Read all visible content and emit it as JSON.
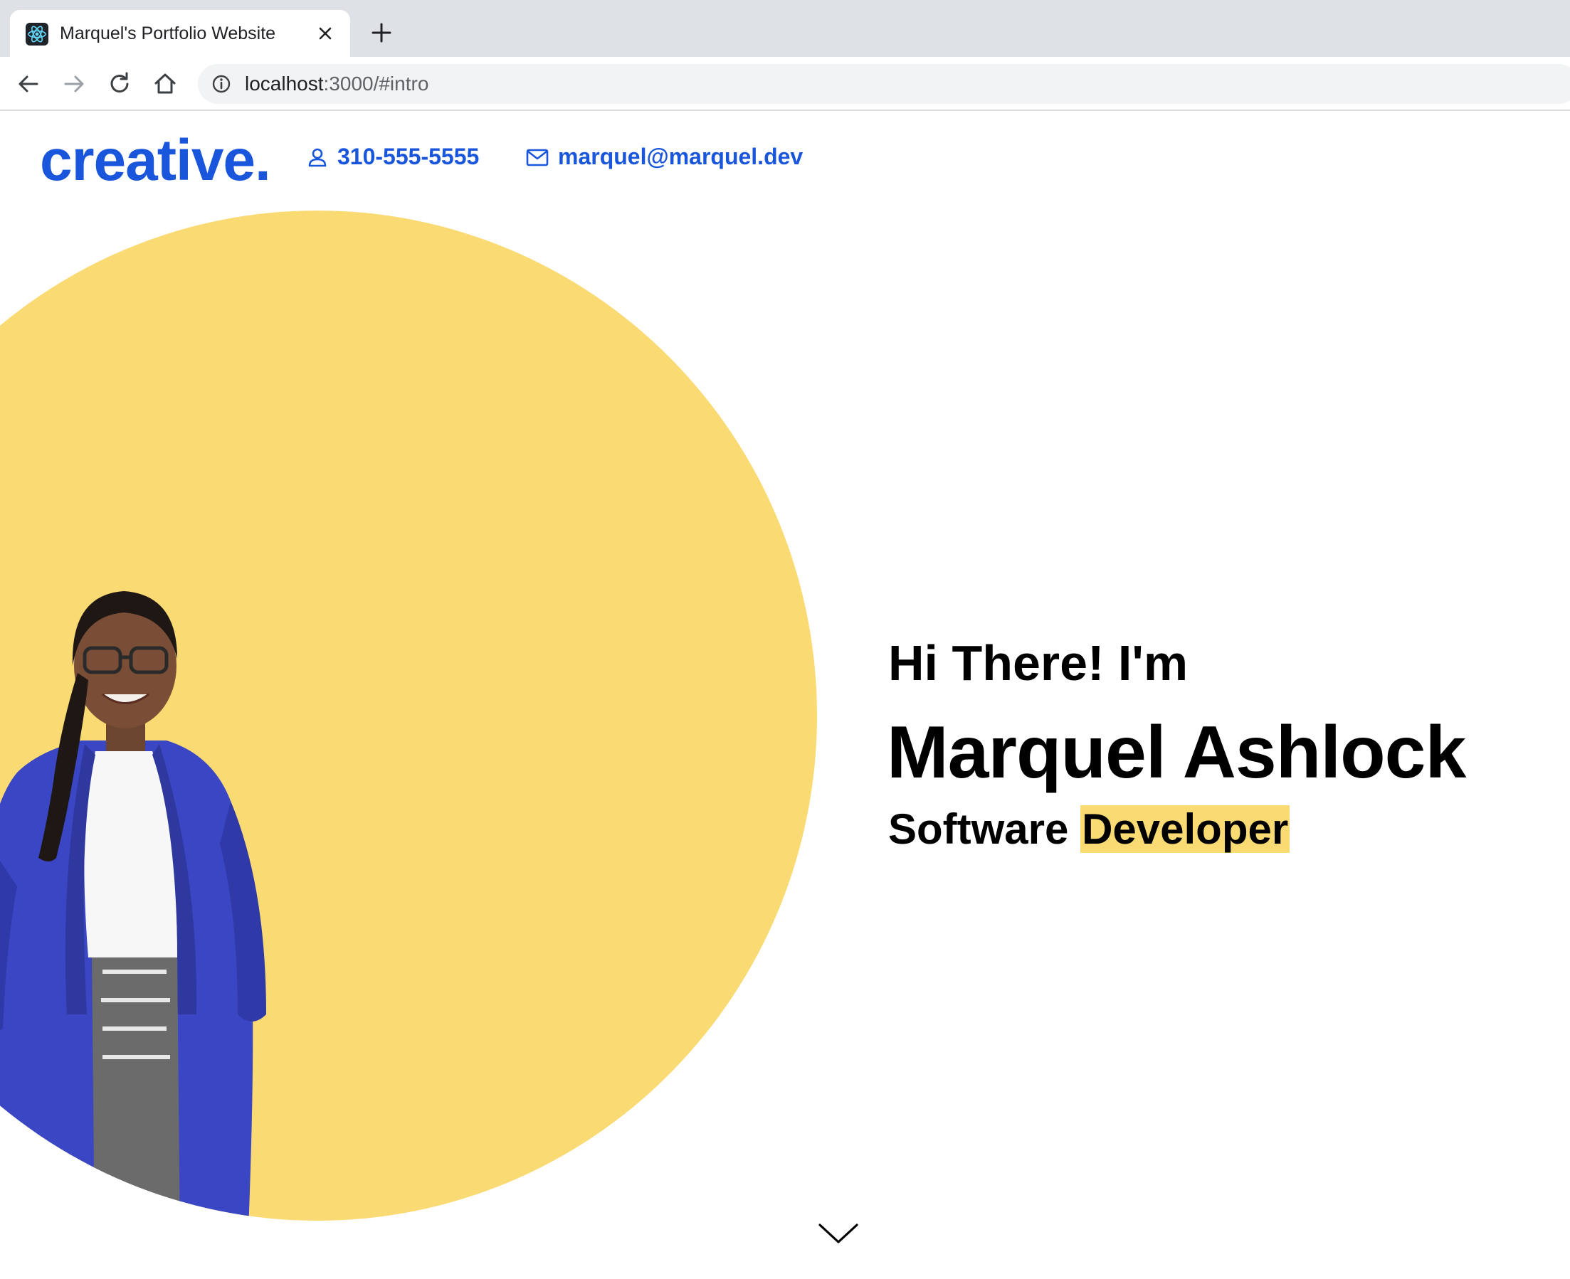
{
  "browser": {
    "tab_title": "Marquel's Portfolio Website",
    "url_host": "localhost",
    "url_rest": ":3000/#intro",
    "icons": {
      "favicon": "react-atom-icon",
      "close": "close-icon",
      "new_tab": "plus-icon",
      "back": "back-arrow-icon",
      "forward": "forward-arrow-icon",
      "reload": "reload-icon",
      "home": "home-icon",
      "site_info": "info-icon"
    }
  },
  "header": {
    "logo": "creative.",
    "phone": "310-555-5555",
    "email": "marquel@marquel.dev",
    "icons": {
      "phone": "person-icon",
      "email": "mail-icon"
    }
  },
  "intro": {
    "greeting": "Hi There! I'm",
    "name": "Marquel Ashlock",
    "role_prefix": "Software",
    "role_highlight": "Developer",
    "scroll_icon": "chevron-down-icon"
  },
  "colors": {
    "accent_blue": "#1a56db",
    "accent_yellow": "#fada72",
    "text": "#000000"
  }
}
